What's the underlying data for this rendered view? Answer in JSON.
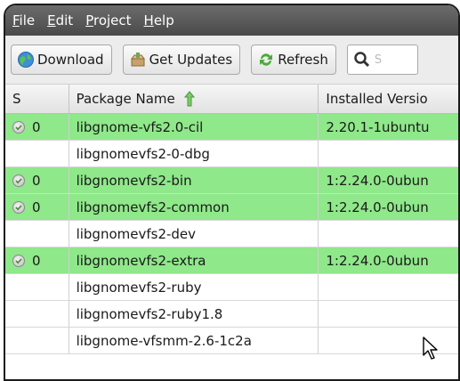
{
  "menu": [
    {
      "label": "File",
      "mnemonic": "F",
      "rest": "ile"
    },
    {
      "label": "Edit",
      "mnemonic": "E",
      "rest": "dit"
    },
    {
      "label": "Project",
      "mnemonic": "P",
      "rest": "roject"
    },
    {
      "label": "Help",
      "mnemonic": "H",
      "rest": "elp"
    }
  ],
  "toolbar": {
    "download_label": "Download",
    "get_updates_label": "Get Updates",
    "refresh_label": "Refresh",
    "search_partial": "S"
  },
  "columns": {
    "status": "S",
    "name": "Package Name",
    "installed": "Installed Versio"
  },
  "sort": {
    "column": "Package Name",
    "direction": "ascending"
  },
  "colors": {
    "installed_row": "#8fe88a"
  },
  "rows": [
    {
      "status": "0",
      "installed": true,
      "name": "libgnome-vfs2.0-cil",
      "version": "2.20.1-1ubuntu"
    },
    {
      "status": "",
      "installed": false,
      "name": "libgnomevfs2-0-dbg",
      "version": ""
    },
    {
      "status": "0",
      "installed": true,
      "name": "libgnomevfs2-bin",
      "version": "1:2.24.0-0ubun"
    },
    {
      "status": "0",
      "installed": true,
      "name": "libgnomevfs2-common",
      "version": "1:2.24.0-0ubun"
    },
    {
      "status": "",
      "installed": false,
      "name": "libgnomevfs2-dev",
      "version": ""
    },
    {
      "status": "0",
      "installed": true,
      "name": "libgnomevfs2-extra",
      "version": "1:2.24.0-0ubun"
    },
    {
      "status": "",
      "installed": false,
      "name": "libgnomevfs2-ruby",
      "version": ""
    },
    {
      "status": "",
      "installed": false,
      "name": "libgnomevfs2-ruby1.8",
      "version": ""
    },
    {
      "status": "",
      "installed": false,
      "name": "libgnome-vfsmm-2.6-1c2a",
      "version": ""
    }
  ]
}
